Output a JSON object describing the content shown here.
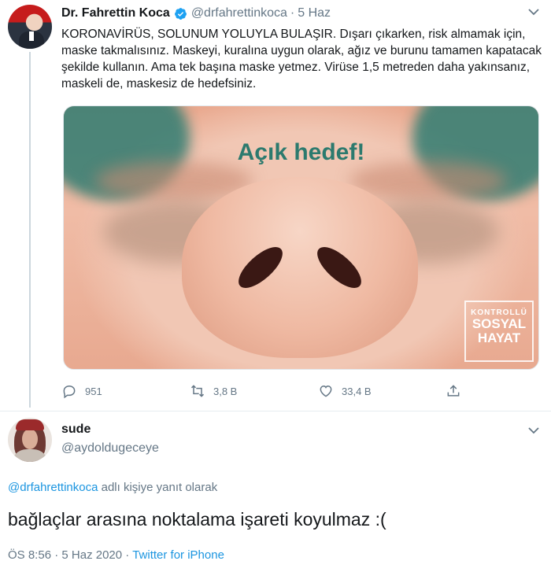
{
  "tweet1": {
    "author_name": "Dr. Fahrettin Koca",
    "handle": "@drfahrettinkoca",
    "separator": "·",
    "date": "5 Haz",
    "text": "KORONAVİRÜS, SOLUNUM YOLUYLA BULAŞIR. Dışarı çıkarken, risk almamak için, maske takmalısınız. Maskeyi, kuralına uygun olarak, ağız ve burunu tamamen kapatacak şekilde kullanın. Ama tek başına maske yetmez. Virüse 1,5 metreden daha yakınsanız, maskeli de, maskesiz de hedefsiniz.",
    "media": {
      "caption": "Açık hedef!",
      "logo_line1": "KONTROLLÜ",
      "logo_line2": "SOSYAL",
      "logo_line3": "HAYAT"
    },
    "actions": {
      "replies": "951",
      "retweets": "3,8 B",
      "likes": "33,4 B"
    }
  },
  "tweet2": {
    "author_name": "sude",
    "handle": "@aydoldugeceye",
    "replying_mention": "@drfahrettinkoca",
    "replying_suffix": " adlı kişiye yanıt olarak",
    "text": "bağlaçlar arasına noktalama işareti koyulmaz :(",
    "time": "ÖS 8:56",
    "date": "5 Haz 2020",
    "separator": "·",
    "source": "Twitter for iPhone"
  },
  "colors": {
    "link": "#1b95e0",
    "secondary_text": "#657786",
    "primary_text": "#14171a",
    "verified": "#1da1f2"
  },
  "icons": [
    "verified-icon",
    "chevron-down-icon",
    "reply-icon",
    "retweet-icon",
    "like-icon",
    "share-icon"
  ]
}
